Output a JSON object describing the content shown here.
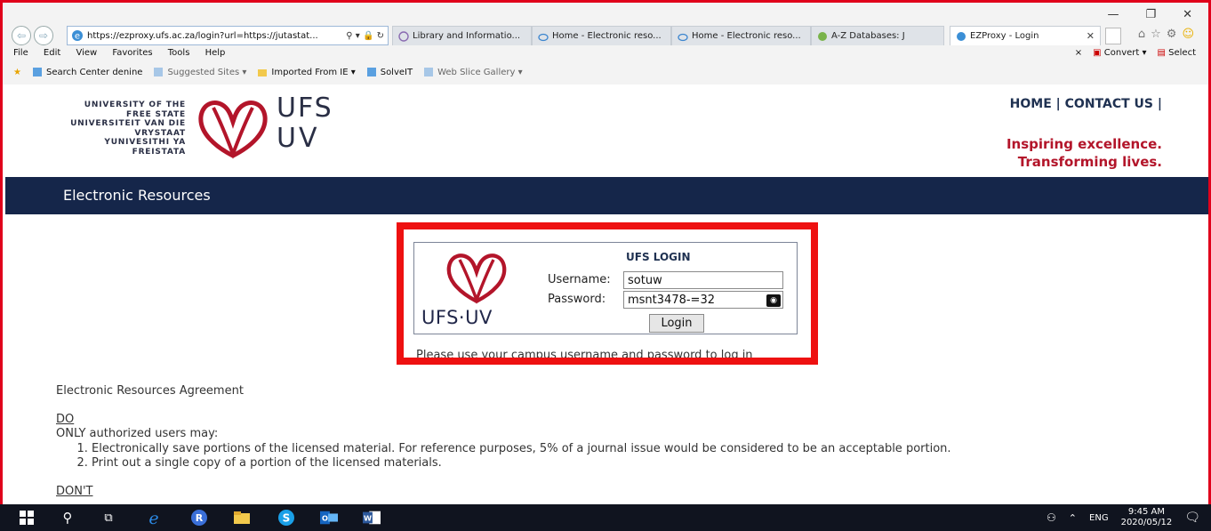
{
  "browser": {
    "address": "https://ezproxy.ufs.ac.za/login?url=https://jutastat...",
    "tabs": [
      {
        "label": "Library and Informatio..."
      },
      {
        "label": "Home - Electronic reso..."
      },
      {
        "label": "Home - Electronic reso..."
      },
      {
        "label": "A-Z Databases: J"
      },
      {
        "label": "EZProxy - Login"
      }
    ],
    "menu": [
      "File",
      "Edit",
      "View",
      "Favorites",
      "Tools",
      "Help"
    ],
    "menu_right": {
      "close": "×",
      "convert": "Convert",
      "select": "Select"
    },
    "favorites": [
      {
        "label": "Search Center denine"
      },
      {
        "label": "Suggested Sites"
      },
      {
        "label": "Imported From IE"
      },
      {
        "label": "SolveIT"
      },
      {
        "label": "Web Slice Gallery"
      }
    ]
  },
  "header": {
    "university_lines": [
      "UNIVERSITY OF THE",
      "FREE STATE",
      "UNIVERSITEIT VAN DIE",
      "VRYSTAAT",
      "YUNIVESITHI YA",
      "FREISTATA"
    ],
    "logo_top": "UFS",
    "logo_bottom": "UV",
    "nav": {
      "home": "HOME",
      "contact": "CONTACT US",
      "sep": "|"
    },
    "tagline_1": "Inspiring excellence.",
    "tagline_2": "Transforming lives."
  },
  "banner": {
    "title": "Electronic Resources"
  },
  "login": {
    "title": "UFS LOGIN",
    "username_label": "Username:",
    "username_value": "sotuw",
    "password_label": "Password:",
    "password_value": "msnt3478-=32",
    "button": "Login",
    "brand": "UFS·UV",
    "hint": "Please use your campus username and password to log in"
  },
  "agreement": {
    "title": "Electronic Resources Agreement",
    "do_heading": "DO",
    "do_intro": "ONLY authorized users may:",
    "do_items": [
      "Electronically save portions of the licensed material. For reference purposes, 5% of a journal issue would be considered to be an acceptable portion.",
      "Print out a single copy of a portion of the licensed materials."
    ],
    "dont_heading": "DON'T"
  },
  "taskbar": {
    "lang": "ENG",
    "time": "9:45 AM",
    "date": "2020/05/12"
  },
  "colors": {
    "banner": "#15264a",
    "accent_red": "#b3152a",
    "highlight": "#ee1111",
    "taskbar": "#10141f"
  }
}
